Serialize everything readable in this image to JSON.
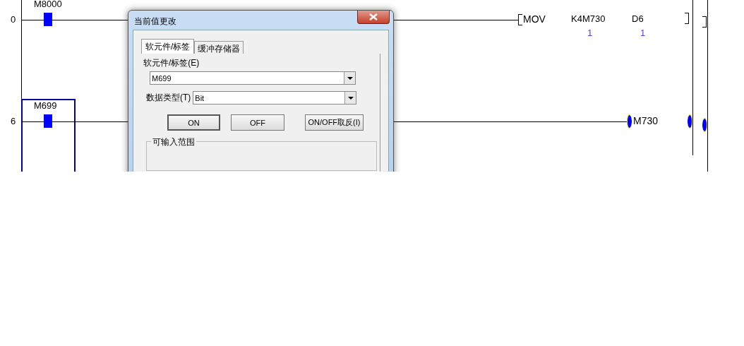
{
  "ladder": {
    "rungs": [
      {
        "step": "0",
        "selected": false,
        "contact": {
          "label": "M8000",
          "on": true
        },
        "instruction": {
          "kind": "mov",
          "op": "MOV",
          "args": [
            {
              "name": "K4M730",
              "value": "1"
            },
            {
              "name": "D6",
              "value": "1"
            }
          ]
        }
      },
      {
        "step": "6",
        "selected": true,
        "contact": {
          "label": "M699",
          "on": true
        },
        "instruction": {
          "kind": "coil",
          "device": "M730",
          "on": true
        }
      }
    ]
  },
  "dialog": {
    "title": "当前值更改",
    "tabs": [
      {
        "label": "软元件/标签",
        "selected": true
      },
      {
        "label": "缓冲存储器",
        "selected": false
      }
    ],
    "device_label": "软元件/标签(E)",
    "device_value": "M699",
    "type_label": "数据类型(T)",
    "type_value": "Bit",
    "buttons": [
      {
        "label": "ON",
        "default": true
      },
      {
        "label": "OFF",
        "default": false
      },
      {
        "label": "ON/OFF取反(I)",
        "default": false
      }
    ],
    "range_group": "可输入范围"
  }
}
